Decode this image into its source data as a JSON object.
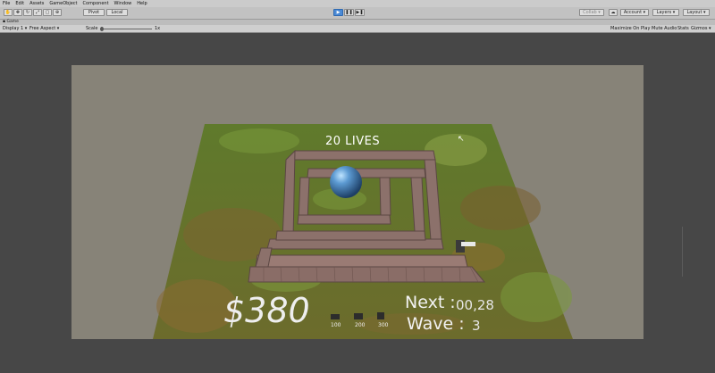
{
  "menu": [
    "File",
    "Edit",
    "Assets",
    "GameObject",
    "Component",
    "Window",
    "Help"
  ],
  "toolbar": {
    "pivot": "Pivot",
    "local": "Local",
    "play": "▶",
    "pause": "❚❚",
    "step": "▶❚",
    "collab": "Collab ▾",
    "account": "Account ▾",
    "layers": "Layers ▾",
    "layout": "Layout ▾"
  },
  "tab": {
    "title": "Game"
  },
  "gamebar": {
    "display": "Display 1",
    "aspect": "Free Aspect",
    "scale_label": "Scale",
    "scale_value": "1x",
    "maximize": "Maximize On Play",
    "mute": "Mute Audio",
    "stats": "Stats",
    "gizmos": "Gizmos"
  },
  "hud": {
    "lives": "20 LIVES",
    "money": "$380",
    "next_label": "Next :",
    "next_value": "00,28",
    "wave_label": "Wave :",
    "wave_value": "3",
    "towers": [
      {
        "cost": "100"
      },
      {
        "cost": "200"
      },
      {
        "cost": "300"
      }
    ]
  },
  "colors": {
    "grass": "#6f7f35",
    "wall": "#8a6f69",
    "orb": "#4f8fc8",
    "background": "#878378"
  }
}
